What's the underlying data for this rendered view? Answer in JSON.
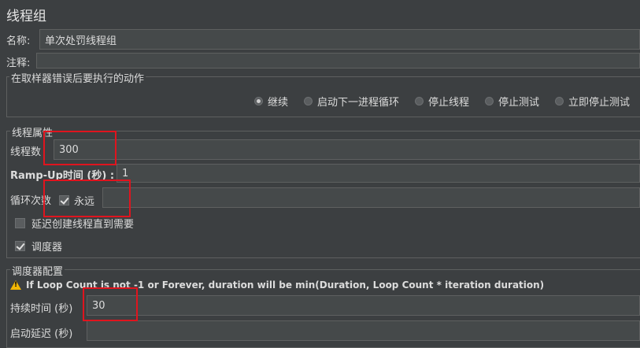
{
  "panel": {
    "title": "线程组"
  },
  "fields": {
    "name": {
      "label": "名称:",
      "value": "单次处罚线程组"
    },
    "comment": {
      "label": "注释:",
      "value": ""
    }
  },
  "sampler_error": {
    "title": "在取样器错误后要执行的动作",
    "options": [
      "继续",
      "启动下一进程循环",
      "停止线程",
      "停止测试",
      "立即停止测试"
    ],
    "selected": "继续"
  },
  "thread_props": {
    "title": "线程属性",
    "thread_count": {
      "label": "线程数",
      "value": "300"
    },
    "ramp_up": {
      "label": "Ramp-Up时间 (秒) :",
      "value": "1"
    },
    "loop": {
      "label": "循环次数",
      "forever_label": "永远",
      "forever_checked": true,
      "value": ""
    },
    "delay_create": {
      "label": "延迟创建线程直到需要",
      "checked": false
    },
    "scheduler": {
      "label": "调度器",
      "checked": true
    }
  },
  "scheduler_config": {
    "title": "调度器配置",
    "warning": "If Loop Count is not -1 or Forever, duration will be min(Duration, Loop Count * iteration duration)",
    "duration": {
      "label": "持续时间 (秒)",
      "value": "30"
    },
    "startup_delay": {
      "label": "启动延迟 (秒)",
      "value": ""
    }
  },
  "colors": {
    "highlight_box": "#e0141e",
    "background": "#3c3f41"
  }
}
